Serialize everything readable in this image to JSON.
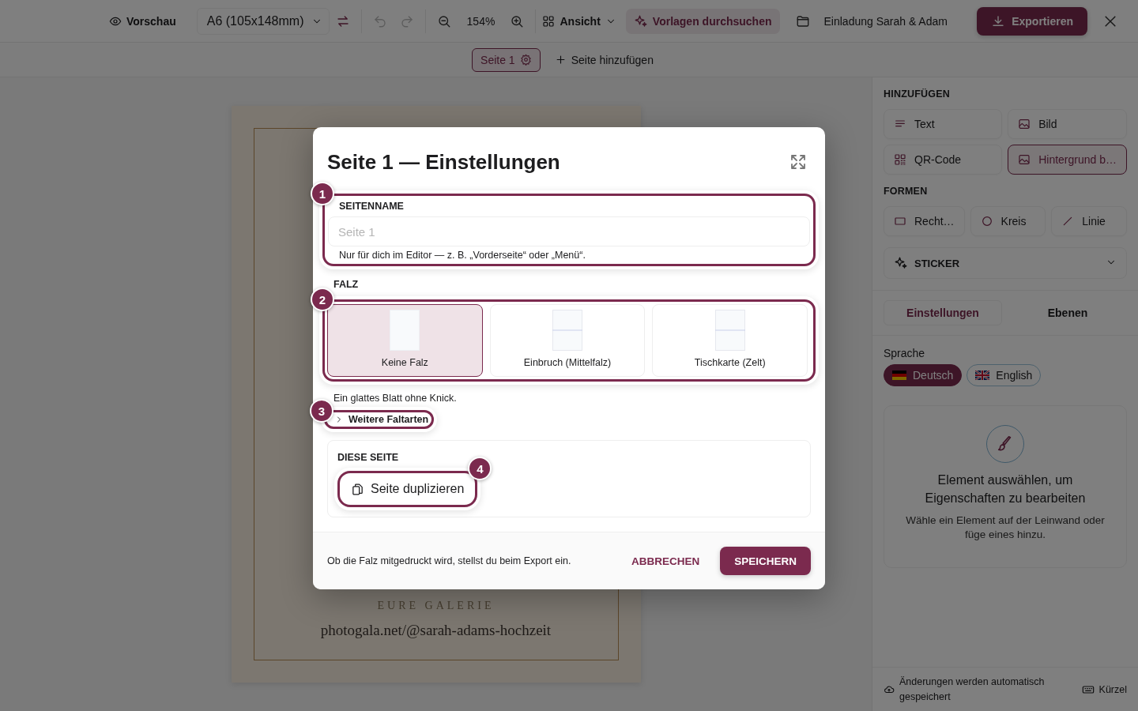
{
  "toolbar": {
    "preview": "Vorschau",
    "format": "A6 (105x148mm)",
    "history": [
      {
        "kind": "undo",
        "disabled": true
      },
      {
        "kind": "redo",
        "disabled": true
      }
    ],
    "zoom": "154%",
    "view": "Ansicht",
    "templates": "Vorlagen durchsuchen",
    "document_title": "Einladung Sarah & Adam",
    "export": "Exportieren"
  },
  "page_bar": {
    "pages": [
      {
        "label": "Seite 1",
        "selected": true
      }
    ],
    "add_page": "Seite hinzufügen"
  },
  "canvas": {
    "texts": [
      "EURE GALERIE",
      "photogala.net/@sarah-adams-hochzeit"
    ]
  },
  "sidebar": {
    "add_heading": "HINZUFÜGEN",
    "add_items": [
      {
        "kind": "text",
        "label": "Text",
        "selected": false
      },
      {
        "kind": "image",
        "label": "Bild",
        "selected": false
      },
      {
        "kind": "qr",
        "label": "QR-Code",
        "selected": false
      },
      {
        "kind": "image",
        "label": "Hintergrund b…",
        "selected": true
      }
    ],
    "shapes_heading": "FORMEN",
    "shapes": [
      {
        "kind": "rect",
        "label": "Recht…"
      },
      {
        "kind": "circle",
        "label": "Kreis"
      },
      {
        "kind": "line",
        "label": "Linie"
      }
    ],
    "sticker": {
      "label": "STICKER",
      "expanded": false
    },
    "tabs": [
      {
        "label": "Einstellungen",
        "selected": true
      },
      {
        "label": "Ebenen",
        "selected": false
      }
    ],
    "language_label": "Sprache",
    "languages": [
      {
        "kind": "de",
        "label": "Deutsch",
        "selected": true
      },
      {
        "kind": "gb",
        "label": "English",
        "selected": false
      }
    ],
    "empty_state": {
      "title": "Element auswählen, um Eigenschaften zu bearbeiten",
      "text": "Wähle ein Element auf der Leinwand oder füge eines hinzu."
    },
    "footer": {
      "status": "Änderungen werden automatisch gespeichert",
      "shortcuts": "Kürzel"
    }
  },
  "dialog": {
    "title": "Seite 1 — Einstellungen",
    "page_name": {
      "step": "1",
      "label": "SEITENNAME",
      "placeholder": "Seite 1",
      "hint": "Nur für dich im Editor — z. B. „Vorderseite“ oder „Menü“."
    },
    "fold": {
      "step": "2",
      "label": "FALZ",
      "options": [
        {
          "kind": "none",
          "label": "Keine Falz",
          "selected": true
        },
        {
          "kind": "center",
          "label": "Einbruch (Mittelfalz)",
          "selected": false
        },
        {
          "kind": "tent",
          "label": "Tischkarte (Zelt)",
          "selected": false
        }
      ],
      "description": "Ein glattes Blatt ohne Knick.",
      "more": {
        "step": "3",
        "label": "Weitere Faltarten",
        "expanded": false
      }
    },
    "this_page": {
      "label": "DIESE SEITE",
      "duplicate": {
        "step": "4",
        "label": "Seite duplizieren"
      }
    },
    "footer_note": "Ob die Falz mitgedruckt wird, stellst du beim Export ein.",
    "cancel": "ABBRECHEN",
    "save": "SPEICHERN"
  }
}
